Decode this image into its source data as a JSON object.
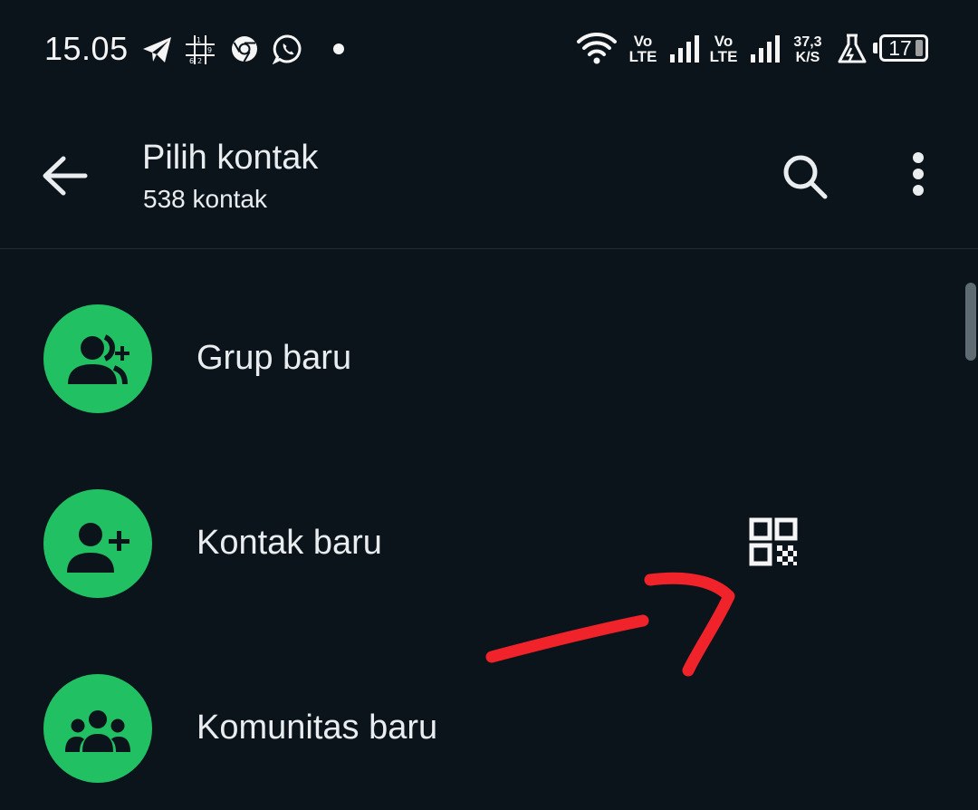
{
  "status_bar": {
    "time": "15.05",
    "notification_icons": [
      "telegram-icon",
      "sudoku-icon",
      "chrome-icon",
      "whatsapp-icon",
      "dot-icon"
    ],
    "sim1_label_top": "Vo",
    "sim1_label_bottom": "LTE",
    "sim2_label_top": "Vo",
    "sim2_label_bottom": "LTE",
    "speed_value": "37,3",
    "speed_unit": "K/S",
    "battery": "17"
  },
  "app_bar": {
    "title": "Pilih kontak",
    "subtitle": "538 kontak"
  },
  "items": [
    {
      "label": "Grup baru",
      "icon": "group-add-icon"
    },
    {
      "label": "Kontak baru",
      "icon": "person-add-icon"
    },
    {
      "label": "Komunitas baru",
      "icon": "community-icon"
    }
  ],
  "colors": {
    "background": "#0b141b",
    "accent": "#21c063",
    "text": "#e9edef",
    "annotation": "#f0222a"
  }
}
